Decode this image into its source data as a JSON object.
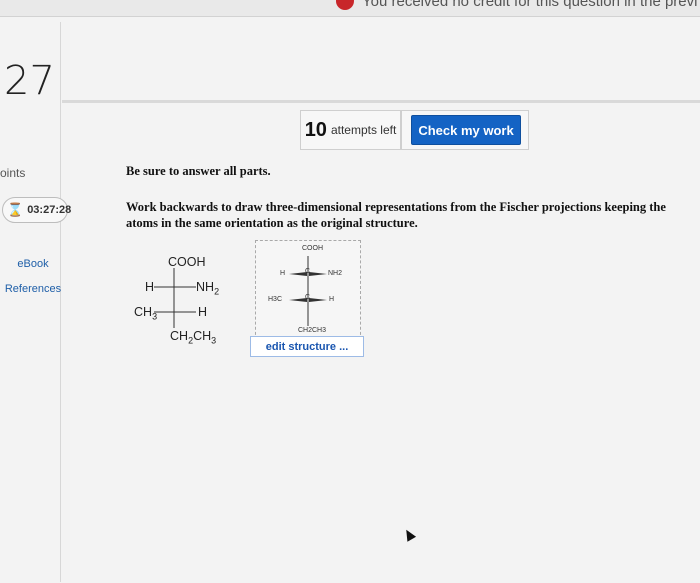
{
  "topbar": {
    "message": "You received no credit for this question in the previ"
  },
  "question": {
    "number": "27",
    "points_label": "oints",
    "timer": "03:27:28",
    "attempts_count": "10",
    "attempts_label": "attempts left",
    "check_button": "Check my work"
  },
  "sidebar": {
    "links": [
      "eBook",
      "References"
    ]
  },
  "content": {
    "instruction_1": "Be sure to answer all parts.",
    "instruction_2": "Work backwards to draw three-dimensional representations from the Fischer projections keeping the atoms in the same orientation as the original structure."
  },
  "fischer": {
    "top": "COOH",
    "left_upper": "H",
    "right_upper": "NH2",
    "left_lower": "CH3",
    "right_lower": "H",
    "bottom": "CH2CH3"
  },
  "structure_preview": {
    "top": "COOH",
    "row1_left": "H",
    "row1_center": "C",
    "row1_right": "NH2",
    "row2_left": "H3C",
    "row2_center": "C",
    "row2_right": "H",
    "bottom": "CH2CH3"
  },
  "edit_button": "edit structure ...",
  "colors": {
    "primary_button": "#1463c4",
    "alert": "#c8262a",
    "link": "#1f5fa8"
  }
}
